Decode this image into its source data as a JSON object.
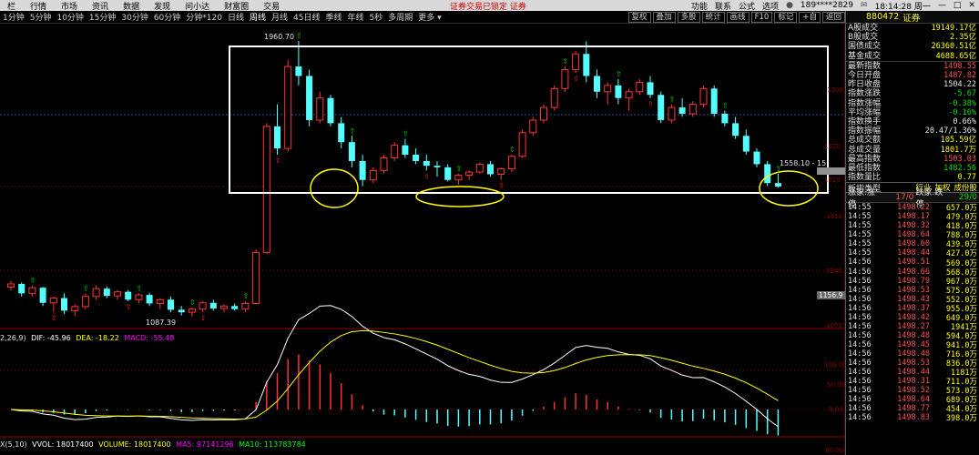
{
  "menubar": {
    "items": [
      "栏",
      "行情",
      "市场",
      "资讯",
      "数据",
      "发现",
      "问小达",
      "财富圈",
      "交易"
    ],
    "warning": "证券交易已锁定  证券",
    "right_items": [
      "功能",
      "联系",
      "公式",
      "选项"
    ],
    "account": "189****2829",
    "clock": "18:14:28 周一",
    "window_buttons": [
      "—",
      "□",
      "✕"
    ]
  },
  "periodbar": {
    "periods": [
      "1分钟",
      "5分钟",
      "10分钟",
      "15分钟",
      "30分钟",
      "60分钟",
      "分钟*120",
      "日线",
      "周线",
      "月线",
      "45日线",
      "季线",
      "年线",
      "5秒",
      "多周期",
      "更多 ▾"
    ],
    "active": "周线",
    "tools": [
      "复权",
      "叠加",
      "多股",
      "统计",
      "画线",
      "F10",
      "标记",
      "+自",
      "返回"
    ]
  },
  "chart": {
    "price_high_label": "1960.70",
    "price_low_label": "1087.39",
    "current_price_tag": "1156.9",
    "range_tag": "1558.10 - 15",
    "right_axis_ticks": [
      "1700",
      "1620",
      "1515",
      "1410",
      "1240",
      "1070"
    ],
    "macd_legend": {
      "params": "2,26,9)",
      "dif": "DIF: -45.96",
      "dea": "DEA: -18.22",
      "macd": "MACD: -55.48"
    },
    "macd_axis": [
      "100.00",
      "50.00",
      "0.00"
    ],
    "vol_legend": {
      "params": "X(5,10)",
      "vvol": "VVOL: 18017400",
      "volume": "VOLUME: 18017400",
      "ma5": "MA5: 97141296",
      "ma10": "MA10: 113783784"
    },
    "vol_axis": "80.00",
    "colors": {
      "up": "#ff3232",
      "down": "#54ffff",
      "dif": "#ffffff",
      "dea": "#ffff00",
      "ma": "#ff00ff",
      "frame": "#ffffff",
      "circle": "#ffff00"
    }
  },
  "panel": {
    "code": "880472",
    "name": "证券",
    "stats": [
      {
        "k": "A股成交",
        "v": "19149.17亿",
        "c": "#ffff00"
      },
      {
        "k": "B股成交",
        "v": "2.35亿",
        "c": "#ffff00"
      },
      {
        "k": "国债成交",
        "v": "26360.51亿",
        "c": "#ffff00"
      },
      {
        "k": "基金成交",
        "v": "4688.65亿",
        "c": "#ffff00"
      }
    ],
    "quotes": [
      {
        "k": "最新指数",
        "v": "1498.55",
        "c": "#ff5050"
      },
      {
        "k": "今日开盘",
        "v": "1487.82",
        "c": "#ff5050"
      },
      {
        "k": "昨日收盘",
        "v": "1504.22",
        "c": "#e6e6e6"
      },
      {
        "k": "指数涨跌",
        "v": "-5.67",
        "c": "#00e000"
      },
      {
        "k": "指数涨幅",
        "v": "-0.38%",
        "c": "#00e000"
      },
      {
        "k": "平均涨幅",
        "v": "-0.16%",
        "c": "#00e000"
      },
      {
        "k": "指数换手",
        "v": "0.66%",
        "c": "#e6e6e6"
      },
      {
        "k": "指数振幅",
        "v": "20.47/1.36%",
        "c": "#e6e6e6"
      },
      {
        "k": "总成交额",
        "v": "105.59亿",
        "c": "#ffff00"
      },
      {
        "k": "总成交量",
        "v": "1801.7万",
        "c": "#ffff00"
      },
      {
        "k": "最高指数",
        "v": "1503.03",
        "c": "#ff5050"
      },
      {
        "k": "最低指数",
        "v": "1482.56",
        "c": "#00e000"
      },
      {
        "k": "指数量比",
        "v": "0.77",
        "c": "#ffff00"
      }
    ],
    "board": {
      "label": "板指类型",
      "tags": [
        "行业",
        "加权",
        "成份股"
      ]
    },
    "updown": {
      "label1": "涨家.涨停",
      "val1": "17/0",
      "label2": "跌家.跌停",
      "val2": "29/0"
    },
    "ticks": [
      {
        "t": "14:55",
        "p": "1498.22",
        "v": "657.0万"
      },
      {
        "t": "14:55",
        "p": "1498.17",
        "v": "479.0万"
      },
      {
        "t": "14:55",
        "p": "1498.32",
        "v": "418.0万"
      },
      {
        "t": "14:55",
        "p": "1498.64",
        "v": "788.0万"
      },
      {
        "t": "14:55",
        "p": "1498.60",
        "v": "439.0万"
      },
      {
        "t": "14:55",
        "p": "1498.44",
        "v": "427.0万"
      },
      {
        "t": "14:56",
        "p": "1498.51",
        "v": "569.0万"
      },
      {
        "t": "14:56",
        "p": "1498.66",
        "v": "568.0万"
      },
      {
        "t": "14:56",
        "p": "1498.79",
        "v": "967.0万"
      },
      {
        "t": "14:56",
        "p": "1498.53",
        "v": "575.0万"
      },
      {
        "t": "14:56",
        "p": "1498.43",
        "v": "552.0万"
      },
      {
        "t": "14:56",
        "p": "1498.37",
        "v": "955.0万"
      },
      {
        "t": "14:56",
        "p": "1498.42",
        "v": "649.0万"
      },
      {
        "t": "14:56",
        "p": "1498.27",
        "v": "1941万"
      },
      {
        "t": "14:56",
        "p": "1498.48",
        "v": "594.0万"
      },
      {
        "t": "14:56",
        "p": "1498.45",
        "v": "941.0万"
      },
      {
        "t": "14:56",
        "p": "1498.48",
        "v": "716.0万"
      },
      {
        "t": "14:56",
        "p": "1498.53",
        "v": "836.0万"
      },
      {
        "t": "14:56",
        "p": "1498.44",
        "v": "1181万"
      },
      {
        "t": "14:56",
        "p": "1498.31",
        "v": "711.0万"
      },
      {
        "t": "14:56",
        "p": "1498.52",
        "v": "573.0万"
      },
      {
        "t": "14:56",
        "p": "1498.64",
        "v": "689.0万"
      },
      {
        "t": "14:56",
        "p": "1498.77",
        "v": "454.0万"
      },
      {
        "t": "14:56",
        "p": "1498.83",
        "v": "398.0万"
      }
    ]
  },
  "chart_data": {
    "type": "candlestick",
    "ohlc": [
      [
        1180,
        1200,
        1170,
        1190
      ],
      [
        1190,
        1195,
        1150,
        1160
      ],
      [
        1160,
        1185,
        1150,
        1178
      ],
      [
        1178,
        1180,
        1120,
        1130
      ],
      [
        1130,
        1150,
        1100,
        1145
      ],
      [
        1145,
        1160,
        1095,
        1105
      ],
      [
        1105,
        1125,
        1088,
        1118
      ],
      [
        1118,
        1160,
        1110,
        1150
      ],
      [
        1150,
        1185,
        1140,
        1175
      ],
      [
        1175,
        1182,
        1145,
        1152
      ],
      [
        1152,
        1170,
        1140,
        1165
      ],
      [
        1165,
        1170,
        1135,
        1140
      ],
      [
        1140,
        1160,
        1128,
        1155
      ],
      [
        1155,
        1162,
        1120,
        1128
      ],
      [
        1128,
        1145,
        1110,
        1140
      ],
      [
        1140,
        1150,
        1100,
        1108
      ],
      [
        1108,
        1120,
        1090,
        1100
      ],
      [
        1100,
        1115,
        1087,
        1110
      ],
      [
        1110,
        1135,
        1100,
        1130
      ],
      [
        1130,
        1140,
        1105,
        1112
      ],
      [
        1112,
        1125,
        1100,
        1120
      ],
      [
        1120,
        1128,
        1105,
        1110
      ],
      [
        1110,
        1135,
        1100,
        1128
      ],
      [
        1128,
        1300,
        1125,
        1290
      ],
      [
        1290,
        1700,
        1285,
        1690
      ],
      [
        1690,
        1760,
        1600,
        1620
      ],
      [
        1620,
        1900,
        1610,
        1880
      ],
      [
        1880,
        1961,
        1820,
        1850
      ],
      [
        1850,
        1870,
        1690,
        1710
      ],
      [
        1710,
        1800,
        1700,
        1780
      ],
      [
        1780,
        1790,
        1690,
        1700
      ],
      [
        1700,
        1720,
        1620,
        1640
      ],
      [
        1640,
        1660,
        1560,
        1580
      ],
      [
        1580,
        1600,
        1500,
        1520
      ],
      [
        1520,
        1560,
        1510,
        1550
      ],
      [
        1550,
        1600,
        1540,
        1590
      ],
      [
        1590,
        1640,
        1580,
        1630
      ],
      [
        1630,
        1650,
        1590,
        1600
      ],
      [
        1600,
        1620,
        1570,
        1580
      ],
      [
        1580,
        1600,
        1550,
        1565
      ],
      [
        1565,
        1580,
        1530,
        1560
      ],
      [
        1560,
        1570,
        1515,
        1520
      ],
      [
        1520,
        1540,
        1505,
        1535
      ],
      [
        1535,
        1550,
        1520,
        1545
      ],
      [
        1545,
        1575,
        1540,
        1570
      ],
      [
        1570,
        1580,
        1530,
        1538
      ],
      [
        1538,
        1560,
        1520,
        1555
      ],
      [
        1555,
        1600,
        1545,
        1595
      ],
      [
        1595,
        1680,
        1590,
        1670
      ],
      [
        1670,
        1720,
        1660,
        1710
      ],
      [
        1710,
        1760,
        1700,
        1750
      ],
      [
        1750,
        1820,
        1740,
        1810
      ],
      [
        1810,
        1880,
        1800,
        1870
      ],
      [
        1870,
        1930,
        1860,
        1920
      ],
      [
        1920,
        1960,
        1830,
        1850
      ],
      [
        1850,
        1870,
        1780,
        1800
      ],
      [
        1800,
        1830,
        1760,
        1820
      ],
      [
        1820,
        1840,
        1760,
        1780
      ],
      [
        1780,
        1810,
        1740,
        1800
      ],
      [
        1800,
        1840,
        1790,
        1830
      ],
      [
        1830,
        1850,
        1780,
        1790
      ],
      [
        1790,
        1800,
        1700,
        1710
      ],
      [
        1710,
        1760,
        1700,
        1750
      ],
      [
        1750,
        1780,
        1720,
        1730
      ],
      [
        1730,
        1770,
        1720,
        1760
      ],
      [
        1760,
        1820,
        1750,
        1810
      ],
      [
        1810,
        1820,
        1720,
        1730
      ],
      [
        1730,
        1740,
        1690,
        1700
      ],
      [
        1700,
        1720,
        1650,
        1660
      ],
      [
        1660,
        1680,
        1600,
        1610
      ],
      [
        1610,
        1620,
        1560,
        1570
      ],
      [
        1570,
        1580,
        1500,
        1510
      ],
      [
        1510,
        1540,
        1495,
        1499
      ]
    ],
    "high_label": 1960.7,
    "low_label": 1087.39,
    "macd": {
      "dif": -45.96,
      "dea": -18.22,
      "macd": -55.48
    },
    "volume": {
      "vvol": 18017400,
      "ma5": 97141296,
      "ma10": 113783784
    }
  }
}
